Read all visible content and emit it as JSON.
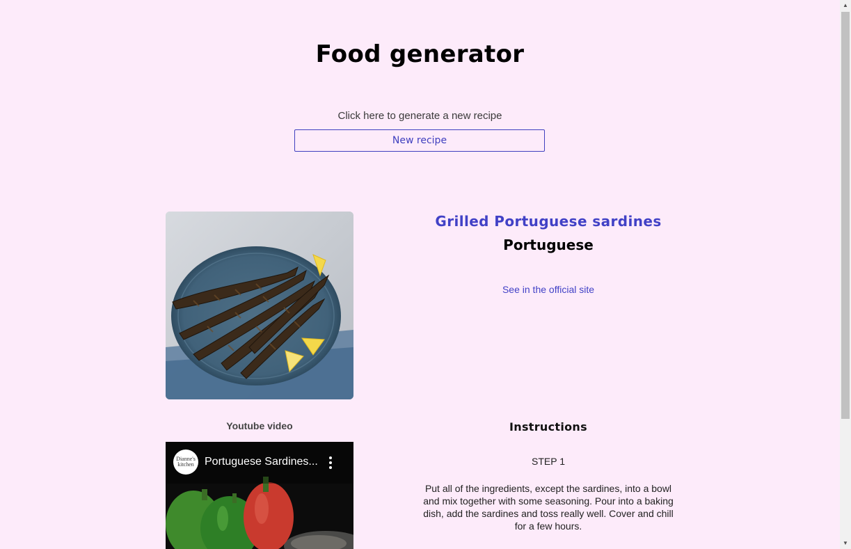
{
  "header": {
    "title": "Food generator",
    "prompt": "Click here to generate a new recipe",
    "button_label": "New recipe"
  },
  "recipe": {
    "name": "Grilled Portuguese sardines",
    "area": "Portuguese",
    "link_text": "See in the official site"
  },
  "video": {
    "section_label": "Youtube video",
    "title": "Portuguese Sardines...",
    "channel_avatar_text": "Dianne's kitchen"
  },
  "instructions": {
    "title": "Instructions",
    "steps": [
      {
        "label": "STEP 1",
        "text": "Put all of the ingredients, except the sardines, into a bowl and mix together with some seasoning. Pour into a baking dish, add the sardines and toss really well. Cover and chill for a few hours."
      }
    ]
  },
  "colors": {
    "background": "#fdebfa",
    "accent": "#4141c6"
  }
}
